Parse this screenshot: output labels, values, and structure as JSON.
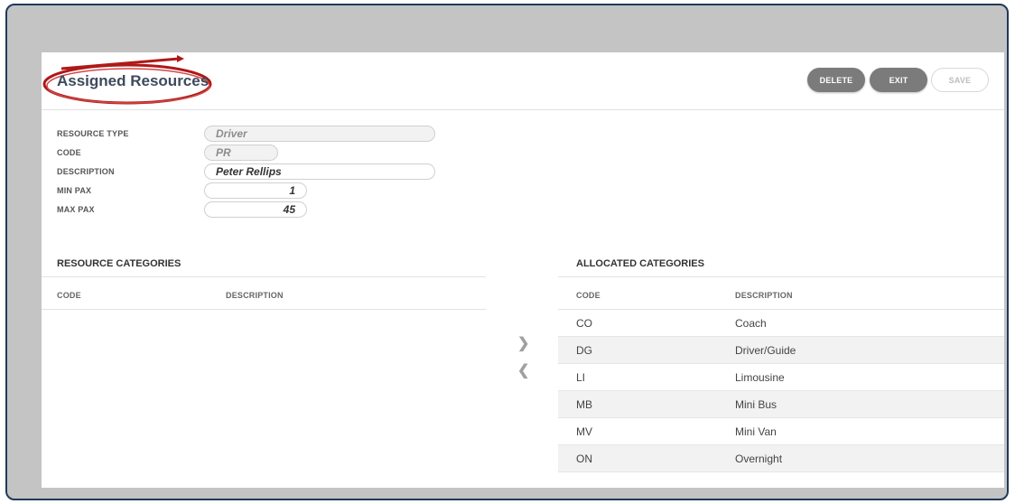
{
  "header": {
    "title": "Assigned Resources",
    "buttons": {
      "delete": "DELETE",
      "exit": "EXIT",
      "save": "SAVE"
    }
  },
  "form": {
    "resource_type": {
      "label": "RESOURCE TYPE",
      "value": "Driver"
    },
    "code": {
      "label": "CODE",
      "value": "PR"
    },
    "description": {
      "label": "DESCRIPTION",
      "value": "Peter Rellips"
    },
    "min_pax": {
      "label": "MIN PAX",
      "value": "1"
    },
    "max_pax": {
      "label": "MAX PAX",
      "value": "45"
    }
  },
  "resource_categories": {
    "title": "RESOURCE CATEGORIES",
    "columns": [
      "CODE",
      "DESCRIPTION"
    ],
    "rows": []
  },
  "allocated_categories": {
    "title": "ALLOCATED CATEGORIES",
    "columns": [
      "CODE",
      "DESCRIPTION"
    ],
    "rows": [
      {
        "code": "CO",
        "description": "Coach"
      },
      {
        "code": "DG",
        "description": "Driver/Guide"
      },
      {
        "code": "LI",
        "description": "Limousine"
      },
      {
        "code": "MB",
        "description": "Mini Bus"
      },
      {
        "code": "MV",
        "description": "Mini Van"
      },
      {
        "code": "ON",
        "description": "Overnight"
      }
    ]
  },
  "transfer": {
    "add_icon": "chevron-right-icon",
    "remove_icon": "chevron-left-icon"
  },
  "colors": {
    "frame_border": "#1f3a5a",
    "backdrop": "#c4c4c4",
    "annotation": "#b01818",
    "button_dark": "#7b7b7b"
  }
}
